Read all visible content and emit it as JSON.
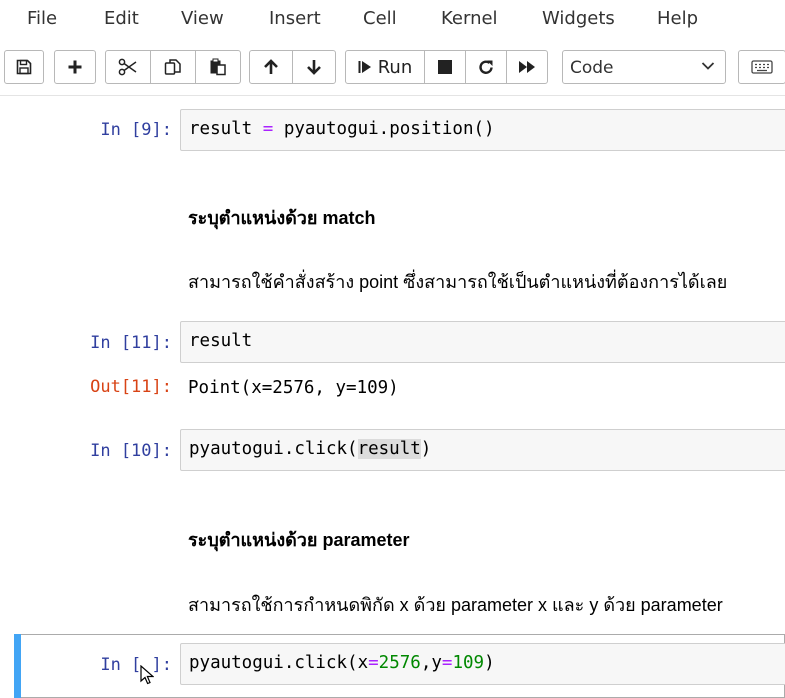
{
  "menu": {
    "items": [
      "File",
      "Edit",
      "View",
      "Insert",
      "Cell",
      "Kernel",
      "Widgets",
      "Help"
    ]
  },
  "toolbar": {
    "run_label": "Run",
    "cell_type": "Code",
    "icons": [
      "save-icon",
      "plus-icon",
      "cut-icon",
      "copy-icon",
      "paste-icon",
      "arrow-up-icon",
      "arrow-down-icon",
      "run-icon",
      "stop-icon",
      "restart-icon",
      "fast-forward-icon",
      "keyboard-icon"
    ]
  },
  "cells": {
    "c1": {
      "prompt": "In [9]:",
      "code_a": "result ",
      "code_op": "=",
      "code_b": " pyautogui.position()"
    },
    "md1": {
      "heading": "ระบุตำแหน่งด้วย match",
      "text": "สามารถใช้คำสั่งสร้าง point ซึ่งสามารถใช้เป็นตำแหน่งที่ต้องการได้เลย"
    },
    "c2": {
      "prompt": "In [11]:",
      "code": "result",
      "out_prompt": "Out[11]:",
      "output": "Point(x=2576, y=109)"
    },
    "c3": {
      "prompt": "In [10]:",
      "code_a": "pyautogui.click(",
      "code_hl": "result",
      "code_b": ")"
    },
    "md2": {
      "heading": "ระบุตำแหน่งด้วย parameter",
      "text": "สามารถใช้การกำหนดพิกัด x ด้วย parameter x และ y ด้วย parameter"
    },
    "c4": {
      "prompt": "In [ ]:",
      "code_a": "pyautogui.click(x",
      "op1": "=",
      "num1": "2576",
      "comma": ",y",
      "op2": "=",
      "num2": "109",
      "code_b": ")"
    }
  },
  "colors": {
    "prompt_in": "#303f9f",
    "prompt_out": "#d84315",
    "selected_bar": "#42a5f5",
    "operator": "#aa22ff",
    "number": "#008800"
  }
}
